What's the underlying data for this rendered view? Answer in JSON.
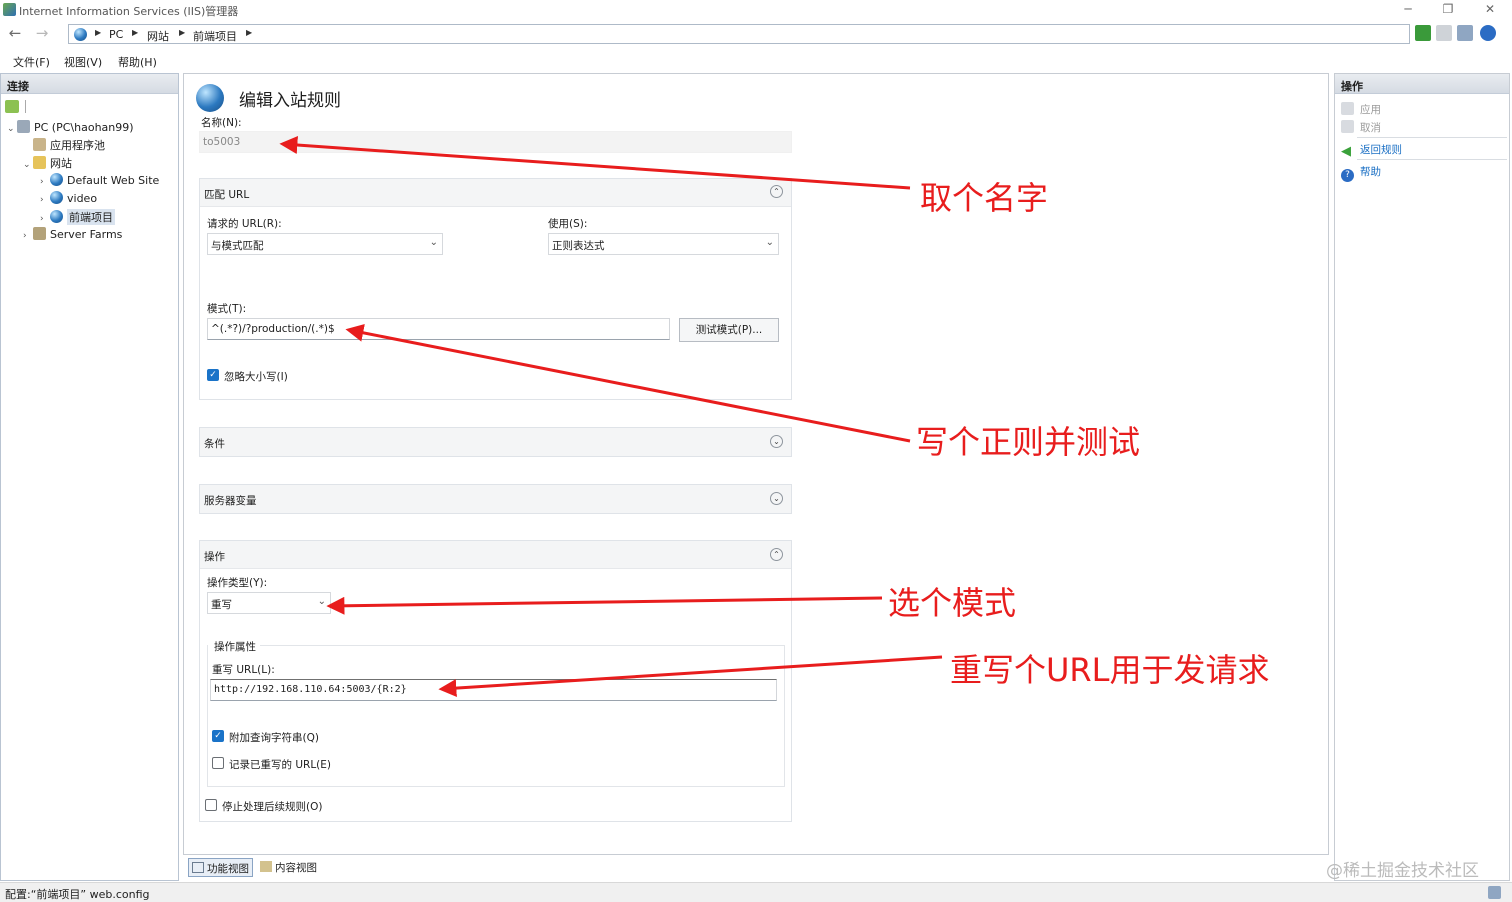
{
  "window": {
    "title": "Internet Information Services (IIS)管理器"
  },
  "address": {
    "crumbs": [
      "PC",
      "网站",
      "前端项目"
    ]
  },
  "menu": [
    "文件(F)",
    "视图(V)",
    "帮助(H)"
  ],
  "connections": {
    "header": "连接",
    "tree": [
      {
        "label": "PC (PC\\haohan99)",
        "icon": "server-icon"
      },
      {
        "label": "应用程序池",
        "icon": "app-pool-icon"
      },
      {
        "label": "网站",
        "icon": "folder-icon"
      },
      {
        "label": "Default Web Site",
        "icon": "globe-icon"
      },
      {
        "label": "video",
        "icon": "globe-icon"
      },
      {
        "label": "前端项目",
        "icon": "globe-icon"
      },
      {
        "label": "Server Farms",
        "icon": "server-farm-icon"
      }
    ]
  },
  "main": {
    "title": "编辑入站规则",
    "name_label": "名称(N):",
    "name_value": "to5003",
    "match_url": {
      "header": "匹配 URL",
      "requested_label": "请求的 URL(R):",
      "requested_value": "与模式匹配",
      "using_label": "使用(S):",
      "using_value": "正则表达式",
      "pattern_label": "模式(T):",
      "pattern_value": "^(.*?)/?production/(.*)$",
      "test_button": "测试模式(P)...",
      "ignore_case_label": "忽略大小写(I)",
      "ignore_case_checked": true
    },
    "conditions": {
      "header": "条件"
    },
    "server_vars": {
      "header": "服务器变量"
    },
    "action": {
      "header": "操作",
      "type_label": "操作类型(Y):",
      "type_value": "重写",
      "props_label": "操作属性",
      "rewrite_label": "重写 URL(L):",
      "rewrite_value": "http://192.168.110.64:5003/{R:2}",
      "append_label": "附加查询字符串(Q)",
      "append_checked": true,
      "log_label": "记录已重写的 URL(E)",
      "log_checked": false
    },
    "stop_label": "停止处理后续规则(O)",
    "stop_checked": false
  },
  "actions": {
    "header": "操作",
    "items": [
      {
        "label": "应用",
        "icon": "apply-icon",
        "enabled": false
      },
      {
        "label": "取消",
        "icon": "cancel-icon",
        "enabled": false
      },
      {
        "label": "返回规则",
        "icon": "back-arrow-icon",
        "enabled": true
      },
      {
        "label": "帮助",
        "icon": "help-icon",
        "enabled": true
      }
    ]
  },
  "bottom_tabs": [
    "功能视图",
    "内容视图"
  ],
  "status": "配置:“前端项目” web.config",
  "annotations": [
    "取个名字",
    "写个正则并测试",
    "选个模式",
    "重写个URL用于发请求"
  ],
  "watermark": "@稀土掘金技术社区",
  "colors": {
    "annotation": "#e81d1d",
    "link": "#1a6fc4",
    "checkbox": "#1a73c8"
  }
}
